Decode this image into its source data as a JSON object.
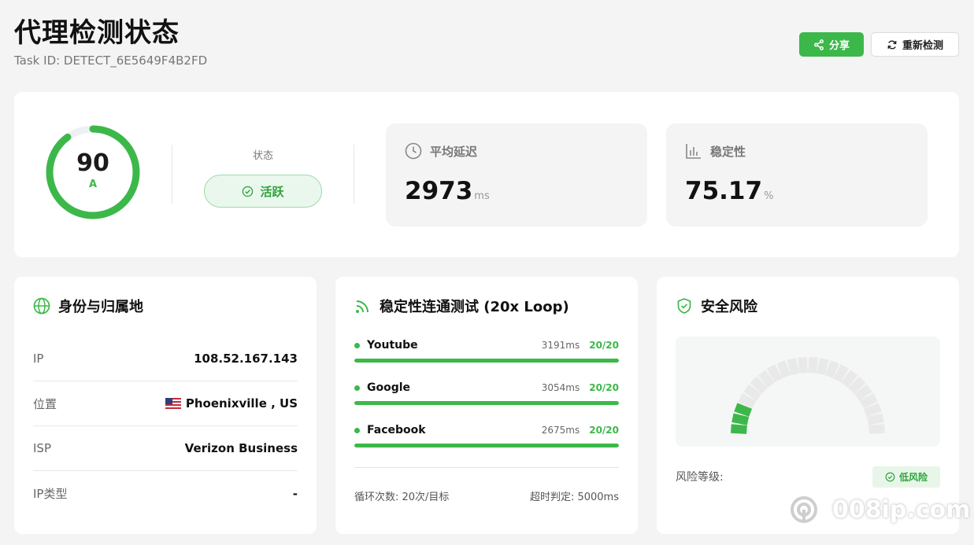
{
  "header": {
    "title": "代理检测状态",
    "task_id": "Task ID: DETECT_6E5649F4B2FD",
    "share_label": "分享",
    "retest_label": "重新检测"
  },
  "summary": {
    "score": "90",
    "grade": "A",
    "score_fraction": 0.9,
    "status_label": "状态",
    "status_value": "活跃",
    "latency_label": "平均延迟",
    "latency_value": "2973",
    "latency_unit": "ms",
    "stability_label": "稳定性",
    "stability_value": "75.17",
    "stability_unit": "%"
  },
  "identity": {
    "title": "身份与归属地",
    "rows": [
      {
        "key": "IP",
        "value": "108.52.167.143"
      },
      {
        "key": "位置",
        "value": "Phoenixville , US"
      },
      {
        "key": "ISP",
        "value": "Verizon Business"
      },
      {
        "key": "IP类型",
        "value": "-"
      }
    ]
  },
  "loop": {
    "title": "稳定性连通测试 (20x Loop)",
    "sites": [
      {
        "name": "Youtube",
        "ms": "3191ms",
        "count": "20/20",
        "progress": 1.0
      },
      {
        "name": "Google",
        "ms": "3054ms",
        "count": "20/20",
        "progress": 1.0
      },
      {
        "name": "Facebook",
        "ms": "2675ms",
        "count": "20/20",
        "progress": 1.0
      }
    ],
    "loops_text": "循环次数: 20次/目标",
    "timeout_text": "超时判定: 5000ms"
  },
  "risk": {
    "title": "安全风险",
    "level_label": "风险等级:",
    "level_value": "低风险",
    "gauge_fraction": 0.14
  },
  "watermark": {
    "text": "008ip.com"
  },
  "colors": {
    "accent": "#3cb84a",
    "background": "#f4f4f4"
  }
}
